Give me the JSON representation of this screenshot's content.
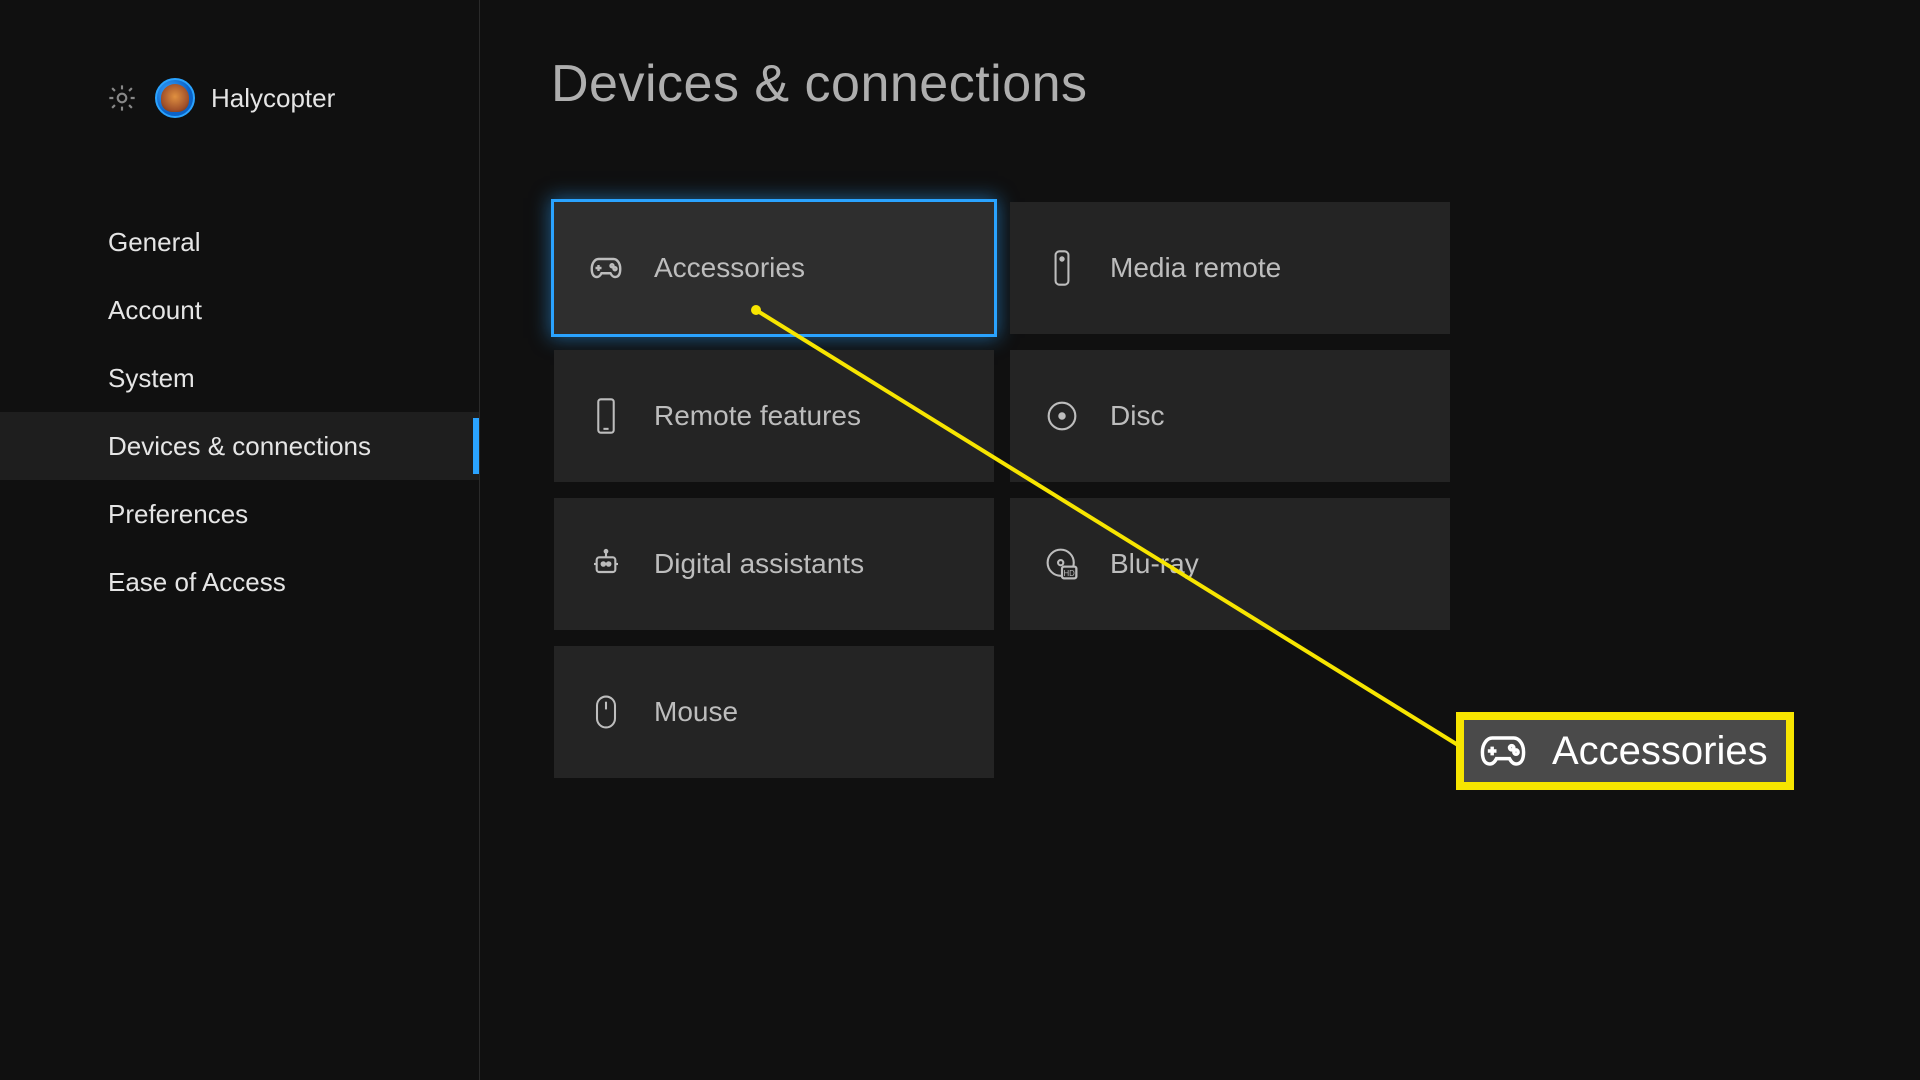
{
  "profile": {
    "name": "Halycopter"
  },
  "sidebar": {
    "items": [
      {
        "label": "General"
      },
      {
        "label": "Account"
      },
      {
        "label": "System"
      },
      {
        "label": "Devices & connections"
      },
      {
        "label": "Preferences"
      },
      {
        "label": "Ease of Access"
      }
    ],
    "active_index": 3
  },
  "page": {
    "title": "Devices & connections"
  },
  "tiles": [
    {
      "icon": "controller",
      "label": "Accessories",
      "focused": true
    },
    {
      "icon": "remote",
      "label": "Media remote"
    },
    {
      "icon": "phone",
      "label": "Remote features"
    },
    {
      "icon": "disc",
      "label": "Disc"
    },
    {
      "icon": "assistant",
      "label": "Digital assistants"
    },
    {
      "icon": "bluray",
      "label": "Blu-ray"
    },
    {
      "icon": "mouse",
      "label": "Mouse"
    }
  ],
  "callout": {
    "label": "Accessories"
  }
}
